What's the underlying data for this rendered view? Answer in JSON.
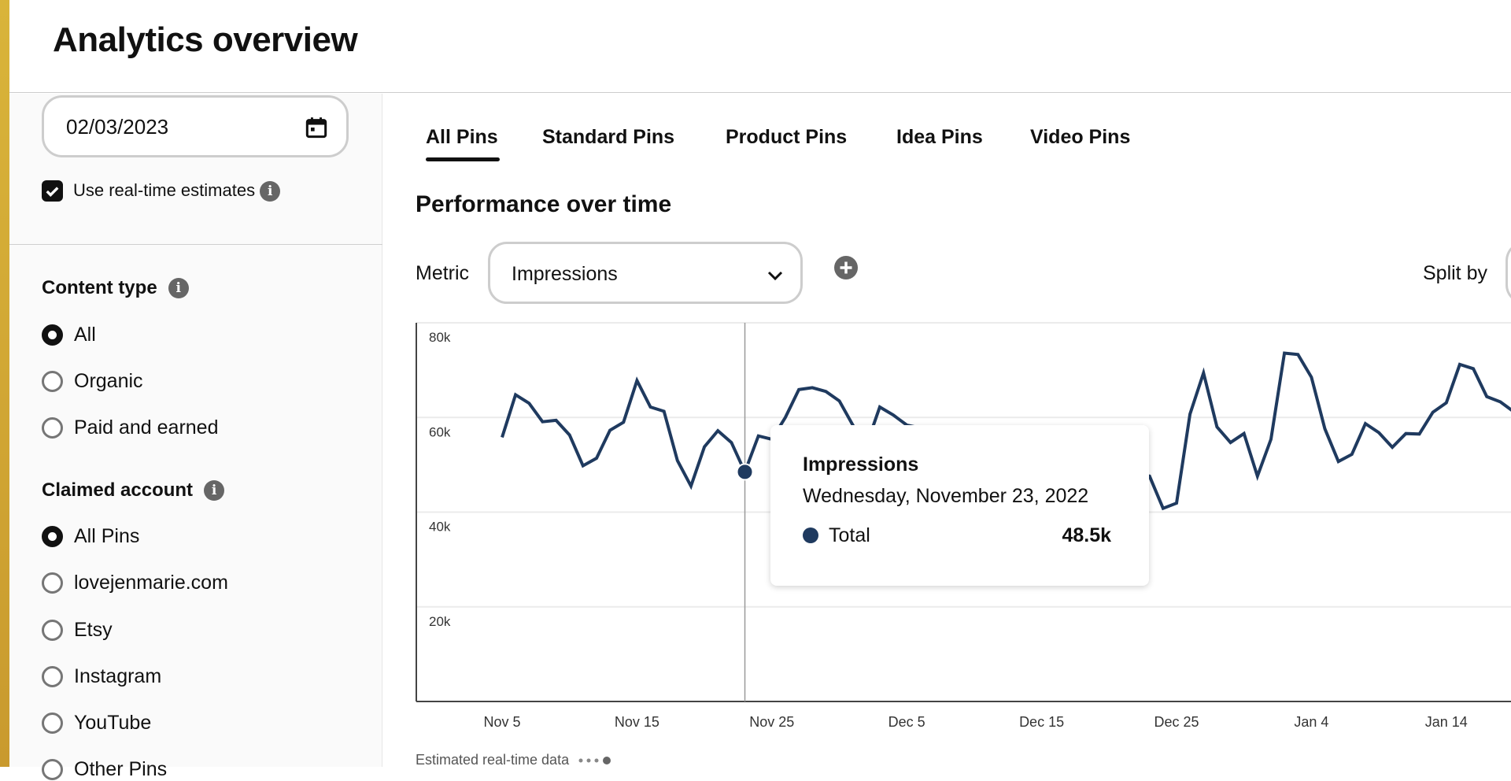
{
  "header": {
    "title": "Analytics overview"
  },
  "sidebar": {
    "date_value": "02/03/2023",
    "realtime": {
      "label": "Use real-time estimates",
      "checked": true
    },
    "content_type": {
      "heading": "Content type",
      "options": [
        "All",
        "Organic",
        "Paid and earned"
      ],
      "selected": "All"
    },
    "claimed_account": {
      "heading": "Claimed account",
      "options": [
        "All Pins",
        "lovejenmarie.com",
        "Etsy",
        "Instagram",
        "YouTube",
        "Other Pins"
      ],
      "selected": "All Pins"
    }
  },
  "tabs": [
    {
      "label": "All Pins",
      "active": true
    },
    {
      "label": "Standard Pins"
    },
    {
      "label": "Product Pins"
    },
    {
      "label": "Idea Pins"
    },
    {
      "label": "Video Pins"
    }
  ],
  "main": {
    "section_title": "Performance over time",
    "metric_label": "Metric",
    "metric_value": "Impressions",
    "split_label": "Split by",
    "footer_note": "Estimated real-time data"
  },
  "tooltip": {
    "title": "Impressions",
    "date": "Wednesday, November 23, 2022",
    "series": "Total",
    "value": "48.5k"
  },
  "colors": {
    "line": "#1f3a5f",
    "accent_strip": "#d4aa35"
  },
  "chart_data": {
    "type": "line",
    "start_date": "2022-11-05",
    "ylim": [
      0,
      80000
    ],
    "yticks": [
      "20k",
      "40k",
      "60k",
      "80k"
    ],
    "xticks": [
      "Nov 5",
      "Nov 15",
      "Nov 25",
      "Dec 5",
      "Dec 15",
      "Dec 25",
      "Jan 4",
      "Jan 14"
    ],
    "grid": true,
    "highlight": {
      "date": "2022-11-23",
      "value": 48500
    },
    "values": [
      55800,
      64800,
      63000,
      59100,
      59400,
      56300,
      49800,
      51400,
      57300,
      59000,
      67800,
      62200,
      61300,
      50900,
      45500,
      53800,
      57200,
      54700,
      48500,
      56100,
      55400,
      60000,
      65900,
      66300,
      65500,
      63500,
      58400,
      54000,
      62200,
      60500,
      58400,
      null,
      null,
      null,
      null,
      null,
      null,
      null,
      null,
      null,
      null,
      null,
      null,
      null,
      null,
      null,
      null,
      null,
      47600,
      40800,
      41900,
      60700,
      69400,
      58000,
      54700,
      56600,
      47600,
      55400,
      73600,
      73300,
      68500,
      57600,
      50700,
      52200,
      58700,
      56800,
      53700,
      56600,
      56500,
      61100,
      63100,
      71200,
      70300,
      64400,
      63300,
      61200
    ]
  }
}
